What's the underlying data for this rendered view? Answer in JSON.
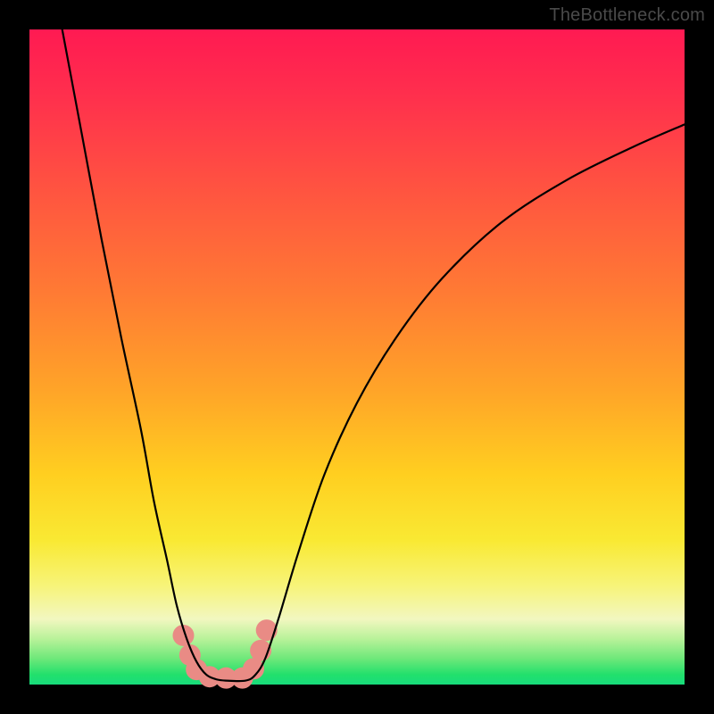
{
  "watermark": "TheBottleneck.com",
  "chart_data": {
    "type": "line",
    "title": "",
    "xlabel": "",
    "ylabel": "",
    "xlim": [
      0,
      100
    ],
    "ylim": [
      0,
      100
    ],
    "grid": false,
    "series": [
      {
        "name": "curve",
        "color": "#000000",
        "x": [
          5,
          8,
          11,
          14,
          17,
          19,
          21,
          22.5,
          24,
          25.5,
          27,
          28.5,
          30,
          33,
          34.5,
          36,
          38,
          41,
          45,
          50,
          56,
          63,
          72,
          82,
          92,
          100
        ],
        "values": [
          100,
          84,
          68,
          53,
          39,
          28,
          19,
          12,
          7,
          3.5,
          1.5,
          0.8,
          0.6,
          0.6,
          1.5,
          4,
          10,
          20,
          32,
          43,
          53,
          62,
          70.5,
          77,
          82,
          85.5
        ]
      }
    ],
    "markers": {
      "name": "highlight-dots",
      "color": "#e98b85",
      "radius": 12,
      "points": [
        {
          "x": 23.5,
          "y": 7.5
        },
        {
          "x": 24.5,
          "y": 4.5
        },
        {
          "x": 25.5,
          "y": 2.3
        },
        {
          "x": 27.5,
          "y": 1.2
        },
        {
          "x": 30.0,
          "y": 1.0
        },
        {
          "x": 32.5,
          "y": 1.0
        },
        {
          "x": 34.2,
          "y": 2.4
        },
        {
          "x": 35.3,
          "y": 5.2
        },
        {
          "x": 36.2,
          "y": 8.3
        }
      ]
    }
  }
}
